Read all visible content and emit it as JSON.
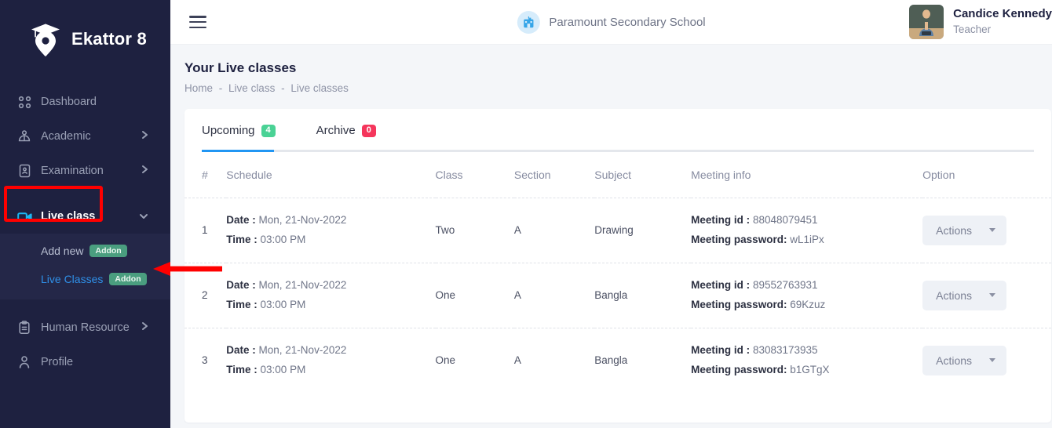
{
  "brand": {
    "name": "Ekattor 8",
    "logo_icon": "graduation-cap-pin-logo"
  },
  "sidebar": {
    "items": [
      {
        "label": "Dashboard",
        "icon": "grid-dots-icon",
        "chevron": ""
      },
      {
        "label": "Academic",
        "icon": "people-icon",
        "chevron": "›"
      },
      {
        "label": "Examination",
        "icon": "exam-file-icon",
        "chevron": "›"
      },
      {
        "label": "Live class",
        "icon": "video-camera-icon",
        "chevron": "⌄",
        "active": true
      },
      {
        "label": "Human Resource",
        "icon": "clipboard-icon",
        "chevron": "›"
      },
      {
        "label": "Profile",
        "icon": "person-icon",
        "chevron": ""
      }
    ],
    "submenu": [
      {
        "label": "Add new",
        "badge": "Addon"
      },
      {
        "label": "Live Classes",
        "badge": "Addon",
        "current": true
      }
    ]
  },
  "topbar": {
    "menu_icon": "hamburger-icon",
    "school": {
      "name": "Paramount Secondary School",
      "icon": "school-building-icon"
    },
    "user": {
      "name": "Candice Kennedy",
      "role": "Teacher",
      "avatar": "teacher-photo"
    }
  },
  "page": {
    "title": "Your Live classes",
    "breadcrumb": [
      "Home",
      "Live class",
      "Live classes"
    ],
    "breadcrumb_separator": "-"
  },
  "tabs": [
    {
      "label": "Upcoming",
      "count": "4",
      "active": true
    },
    {
      "label": "Archive",
      "count": "0",
      "active": false
    }
  ],
  "table": {
    "headers": [
      "#",
      "Schedule",
      "Class",
      "Section",
      "Subject",
      "Meeting info",
      "Option"
    ],
    "labels": {
      "date": "Date :",
      "time": "Time :",
      "meeting_id": "Meeting id :",
      "meeting_password": "Meeting password:"
    },
    "action_label": "Actions",
    "rows": [
      {
        "num": "1",
        "date": "Mon, 21-Nov-2022",
        "time": "03:00 PM",
        "class": "Two",
        "section": "A",
        "subject": "Drawing",
        "meeting_id": "88048079451",
        "meeting_password": "wL1iPx"
      },
      {
        "num": "2",
        "date": "Mon, 21-Nov-2022",
        "time": "03:00 PM",
        "class": "One",
        "section": "A",
        "subject": "Bangla",
        "meeting_id": "89552763931",
        "meeting_password": "69Kzuz"
      },
      {
        "num": "3",
        "date": "Mon, 21-Nov-2022",
        "time": "03:00 PM",
        "class": "One",
        "section": "A",
        "subject": "Bangla",
        "meeting_id": "83083173935",
        "meeting_password": "b1GTgX"
      }
    ]
  },
  "annotations": {
    "highlight_box_target": "Live class",
    "arrow_target": "Live Classes",
    "color": "#ff0000"
  },
  "colors": {
    "sidebar_bg": "#1e2140",
    "accent_blue": "#2196f3",
    "badge_green": "#4ad295",
    "badge_red": "#f5365c",
    "addon_green": "#4a9e7f",
    "page_bg": "#f4f6f9"
  }
}
